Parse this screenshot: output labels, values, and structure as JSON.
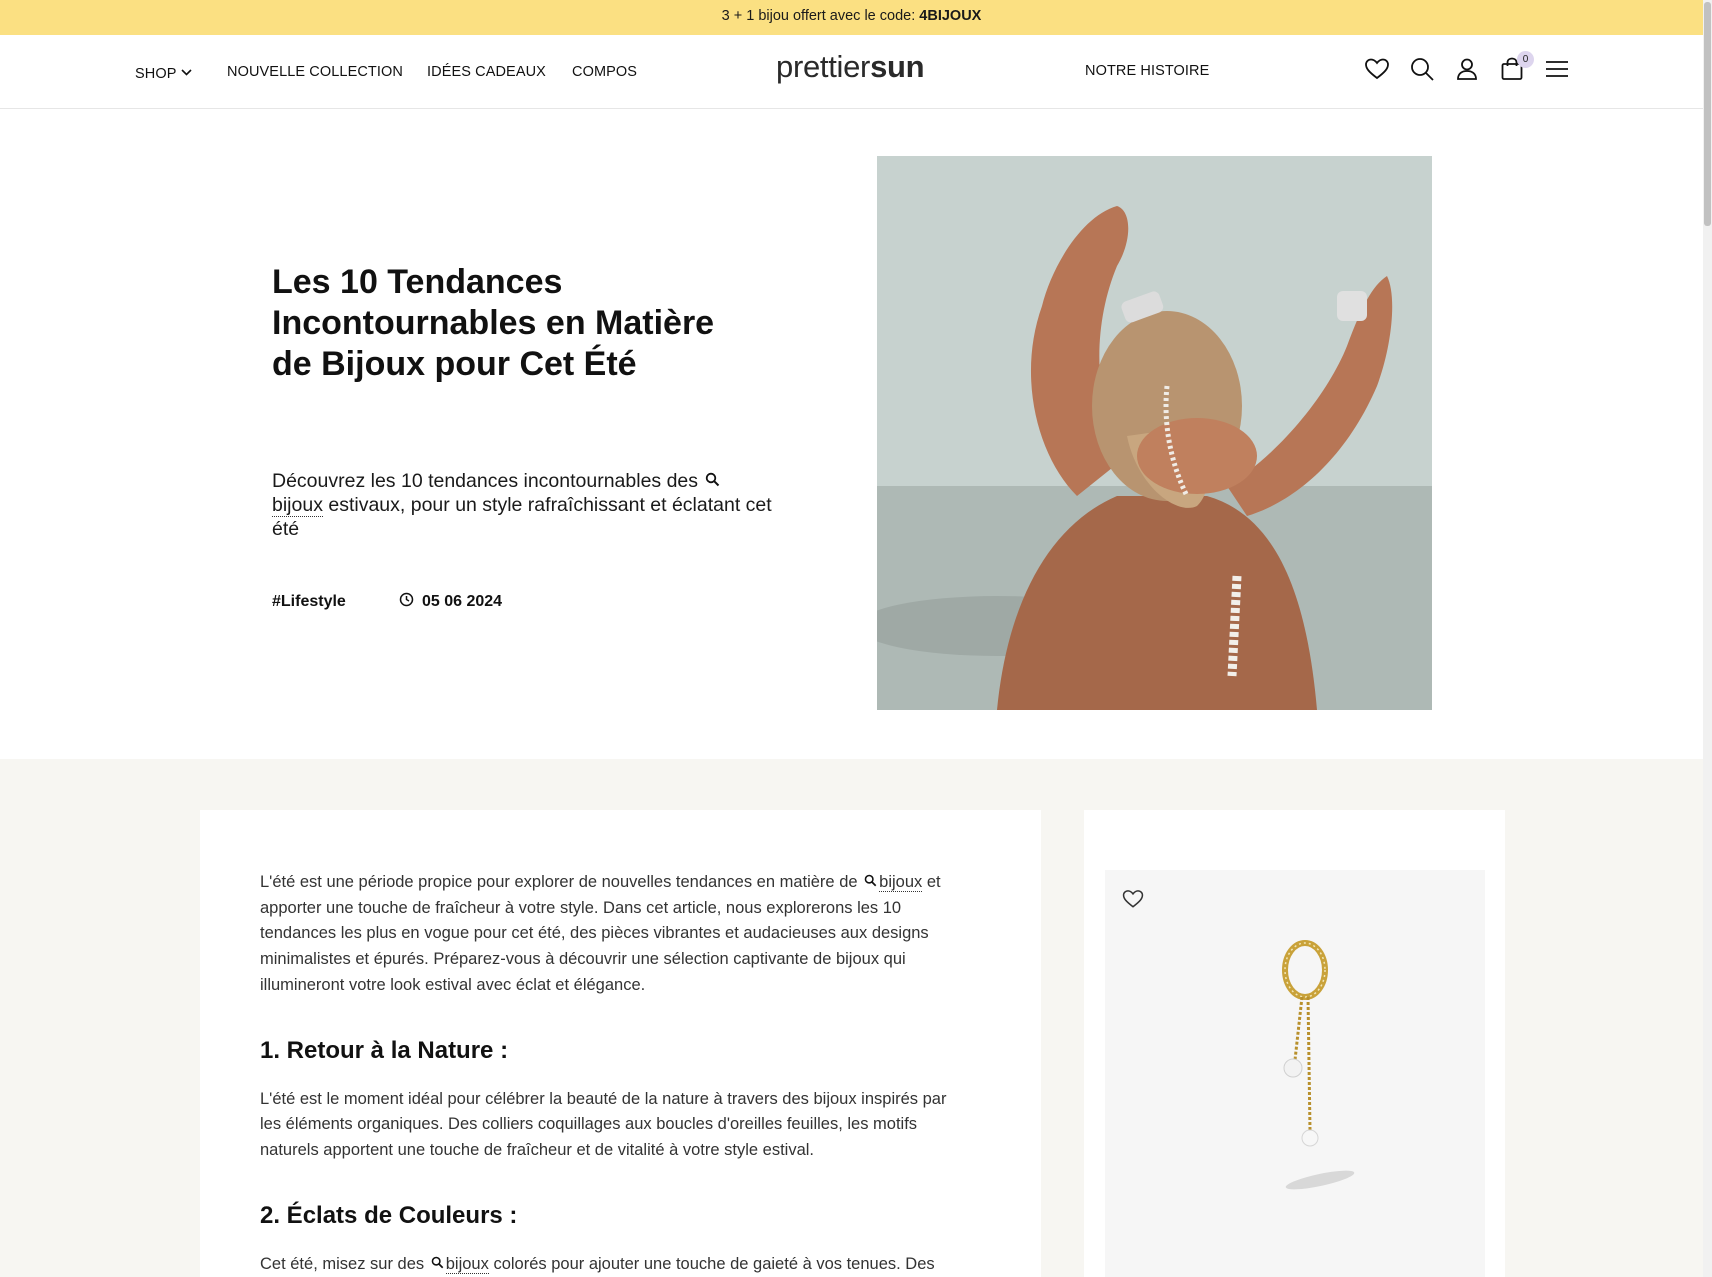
{
  "announcement": {
    "text": "3 + 1 bijou offert avec le code: ",
    "code": "4BIJOUX"
  },
  "nav": {
    "shop": "SHOP",
    "nouvelle_collection": "NOUVELLE COLLECTION",
    "idees_cadeaux": "IDÉES CADEAUX",
    "compos": "COMPOS",
    "notre_histoire": "NOTRE HISTOIRE"
  },
  "logo": {
    "light": "prettier",
    "bold": "sun"
  },
  "header_icons": [
    "heart-icon",
    "search-icon",
    "user-icon",
    "bag-icon",
    "menu-icon"
  ],
  "cart": {
    "count": "0"
  },
  "hero": {
    "title": "Les 10 Tendances Incontournables en Matière de Bijoux pour Cet Été",
    "desc_before": "Découvrez les 10 tendances incontournables des ",
    "desc_keyword": "bijoux",
    "desc_after": " estivaux, pour un style rafraîchissant et éclatant cet été",
    "tag": "#Lifestyle",
    "date": "05 06 2024"
  },
  "article": {
    "intro_before": "L'été est une période propice pour explorer de nouvelles tendances en matière de ",
    "intro_keyword": "bijoux",
    "intro_after": " et apporter une touche de fraîcheur à votre style. Dans cet article, nous explorerons les 10 tendances les plus en vogue pour cet été, des pièces vibrantes et audacieuses aux designs minimalistes et épurés. Préparez-vous à découvrir une sélection captivante de bijoux qui illumineront votre look estival avec éclat et élégance.",
    "h1": "1. Retour à la Nature :",
    "p1": "L'été est le moment idéal pour célébrer la beauté de la nature à travers des bijoux inspirés par les éléments organiques. Des colliers coquillages aux boucles d'oreilles feuilles, les motifs naturels apportent une touche de fraîcheur et de vitalité à votre style estival.",
    "h2": "2. Éclats de Couleurs :",
    "p2_before": "Cet été, misez sur des ",
    "p2_keyword": "bijoux",
    "p2_after": " colorés pour ajouter une touche de gaieté à vos tenues. Des"
  },
  "colors": {
    "announcement_bg": "#fbe082",
    "section_bg": "#f7f6f2",
    "cart_badge": "#ddd5ee"
  }
}
